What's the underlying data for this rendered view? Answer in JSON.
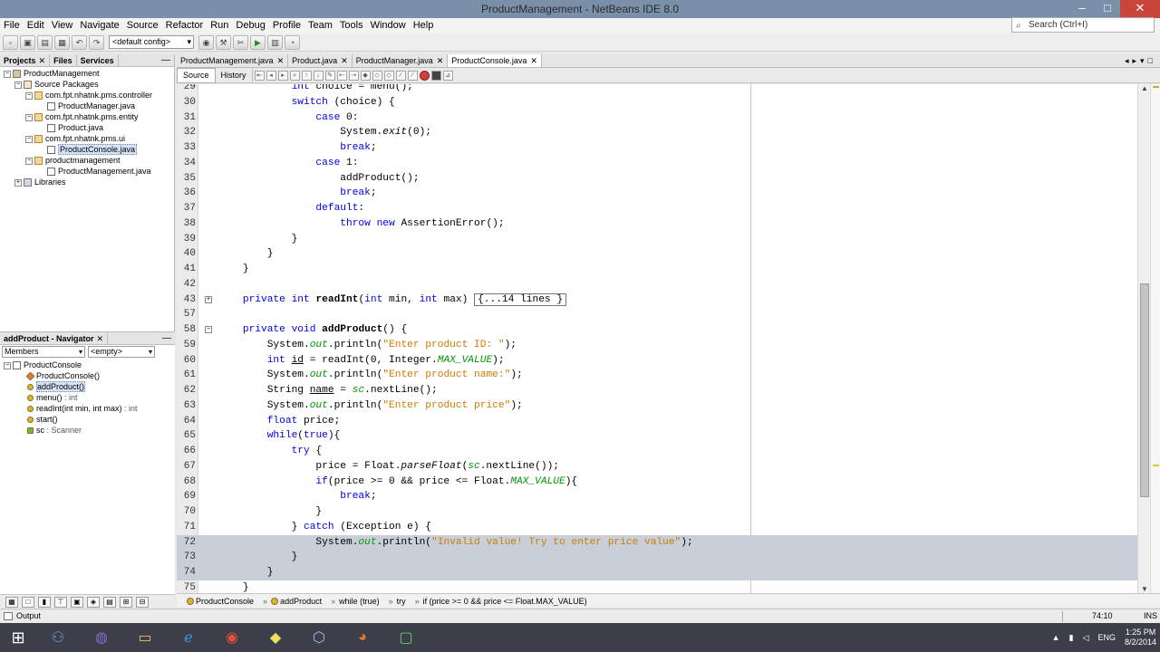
{
  "window": {
    "title": "ProductManagement - NetBeans IDE 8.0"
  },
  "menu": [
    "File",
    "Edit",
    "View",
    "Navigate",
    "Source",
    "Refactor",
    "Run",
    "Debug",
    "Profile",
    "Team",
    "Tools",
    "Window",
    "Help"
  ],
  "search": {
    "placeholder": "Search (Ctrl+I)"
  },
  "toolbar": {
    "config": "<default config>"
  },
  "projects": {
    "tabs": [
      "Projects",
      "Files",
      "Services"
    ],
    "tree": [
      {
        "label": "ProductManagement",
        "level": 0,
        "icon": "project-icon",
        "expanded": true
      },
      {
        "label": "Source Packages",
        "level": 1,
        "icon": "folder-icon",
        "expanded": true
      },
      {
        "label": "com.fpt.nhatnk.pms.controller",
        "level": 2,
        "icon": "package-icon",
        "expanded": true
      },
      {
        "label": "ProductManager.java",
        "level": 3,
        "icon": "java-file-icon"
      },
      {
        "label": "com.fpt.nhatnk.pms.entity",
        "level": 2,
        "icon": "package-icon",
        "expanded": true
      },
      {
        "label": "Product.java",
        "level": 3,
        "icon": "java-file-icon"
      },
      {
        "label": "com.fpt.nhatnk.pms.ui",
        "level": 2,
        "icon": "package-icon",
        "expanded": true
      },
      {
        "label": "ProductConsole.java",
        "level": 3,
        "icon": "java-file-icon",
        "selected": true
      },
      {
        "label": "productmanagement",
        "level": 2,
        "icon": "package-icon",
        "expanded": true
      },
      {
        "label": "ProductManagement.java",
        "level": 3,
        "icon": "java-file-icon"
      },
      {
        "label": "Libraries",
        "level": 1,
        "icon": "library-icon",
        "expanded": false
      }
    ]
  },
  "navigator": {
    "title": "addProduct - Navigator",
    "filter1": "Members",
    "filter2": "<empty>",
    "root": "ProductConsole",
    "members": [
      {
        "name": "ProductConsole()",
        "type": "",
        "kind": "constructor"
      },
      {
        "name": "addProduct()",
        "type": "",
        "kind": "method",
        "selected": true
      },
      {
        "name": "menu()",
        "type": " : int",
        "kind": "method"
      },
      {
        "name": "readInt(int min, int max)",
        "type": " : int",
        "kind": "method"
      },
      {
        "name": "start()",
        "type": "",
        "kind": "method"
      },
      {
        "name": "sc",
        "type": " : Scanner",
        "kind": "field"
      }
    ]
  },
  "editor": {
    "tabs": [
      {
        "label": "ProductManagement.java",
        "active": false
      },
      {
        "label": "Product.java",
        "active": false
      },
      {
        "label": "ProductManager.java",
        "active": false
      },
      {
        "label": "ProductConsole.java",
        "active": true
      }
    ],
    "view_tabs": [
      "Source",
      "History"
    ],
    "lines": [
      {
        "n": "29",
        "html": "            <span class='kw'>int</span> choice = menu();"
      },
      {
        "n": "30",
        "html": "            <span class='kw'>switch</span> (choice) {"
      },
      {
        "n": "31",
        "html": "                <span class='kw'>case</span> 0:"
      },
      {
        "n": "32",
        "html": "                    System.<span class='ital'>exit</span>(0);"
      },
      {
        "n": "33",
        "html": "                    <span class='kw'>break</span>;"
      },
      {
        "n": "34",
        "html": "                <span class='kw'>case</span> 1:"
      },
      {
        "n": "35",
        "html": "                    addProduct();"
      },
      {
        "n": "36",
        "html": "                    <span class='kw'>break</span>;"
      },
      {
        "n": "37",
        "html": "                <span class='kw'>default</span>:"
      },
      {
        "n": "38",
        "html": "                    <span class='kw'>throw</span> <span class='kw'>new</span> AssertionError();"
      },
      {
        "n": "39",
        "html": "            }"
      },
      {
        "n": "40",
        "html": "        }"
      },
      {
        "n": "41",
        "html": "    }"
      },
      {
        "n": "42",
        "html": ""
      },
      {
        "n": "43",
        "html": "    <span class='kw'>private</span> <span class='kw'>int</span> <b>readInt</b>(<span class='kw'>int</span> min, <span class='kw'>int</span> max) <span class='folded'>{...14 lines }</span>",
        "fold": "+"
      },
      {
        "n": "57",
        "html": ""
      },
      {
        "n": "58",
        "html": "    <span class='kw'>private</span> <span class='kw'>void</span> <b>addProduct</b>() {",
        "fold": "−"
      },
      {
        "n": "59",
        "html": "        System.<span class='stat'>out</span>.println(<span class='str'>\"Enter product ID: \"</span>);"
      },
      {
        "n": "60",
        "html": "        <span class='kw'>int</span> <u>id</u> = readInt(0, Integer.<span class='stat'>MAX_VALUE</span>);"
      },
      {
        "n": "61",
        "html": "        System.<span class='stat'>out</span>.println(<span class='str'>\"Enter product name:\"</span>);"
      },
      {
        "n": "62",
        "html": "        String <u>name</u> = <span class='stat'>sc</span>.nextLine();"
      },
      {
        "n": "63",
        "html": "        System.<span class='stat'>out</span>.println(<span class='str'>\"Enter product price\"</span>);"
      },
      {
        "n": "64",
        "html": "        <span class='kw'>float</span> price;"
      },
      {
        "n": "65",
        "html": "        <span class='kw'>while</span>(<span class='kw'>true</span>){"
      },
      {
        "n": "66",
        "html": "            <span class='kw'>try</span> {"
      },
      {
        "n": "67",
        "html": "                price = Float.<span class='ital'>parseFloat</span>(<span class='stat'>sc</span>.nextLine());"
      },
      {
        "n": "68",
        "html": "                <span class='kw'>if</span>(price >= 0 && price <= Float.<span class='stat'>MAX_VALUE</span>){"
      },
      {
        "n": "69",
        "html": "                    <span class='kw'>break</span>;"
      },
      {
        "n": "70",
        "html": "                }"
      },
      {
        "n": "71",
        "html": "            } <span class='kw'>catch</span> (Exception e) {"
      },
      {
        "n": "72",
        "html": "                System.<span class='stat'>out</span>.println(<span class='str'>\"Invalid value! Try to enter price value\"</span>);",
        "selected": true
      },
      {
        "n": "73",
        "html": "            }",
        "selected": true
      },
      {
        "n": "74",
        "html": "        }",
        "selected": true
      },
      {
        "n": "75",
        "html": "    }"
      }
    ]
  },
  "breadcrumb": [
    "ProductConsole",
    "addProduct",
    "while (true)",
    "try",
    "if (price >= 0 && price <= Float.MAX_VALUE)"
  ],
  "status": {
    "output_label": "Output",
    "caret": "74:10",
    "mode": "INS"
  },
  "taskbar": {
    "time": "1:25 PM",
    "date": "8/2/2014",
    "lang": "ENG"
  }
}
